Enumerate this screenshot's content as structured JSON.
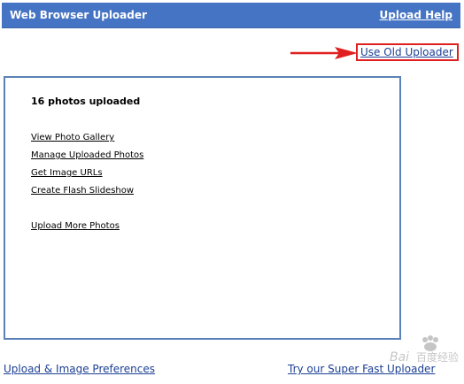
{
  "header": {
    "title": "Web Browser Uploader",
    "help_link": "Upload Help"
  },
  "old_uploader": {
    "label": "Use Old Uploader"
  },
  "content": {
    "status": "16 photos uploaded",
    "links": [
      "View Photo Gallery",
      "Manage Uploaded Photos",
      "Get Image URLs",
      "Create Flash Slideshow",
      "Upload More Photos"
    ]
  },
  "footer": {
    "preferences_link": "Upload & Image Preferences",
    "fast_uploader_link": "Try our Super Fast Uploader"
  },
  "watermark": {
    "text": "Bai百度经验"
  },
  "colors": {
    "header_background": "#4674c4",
    "link_blue": "#1c3f94",
    "highlight_red": "#e02020",
    "box_border": "#5b82b8"
  }
}
